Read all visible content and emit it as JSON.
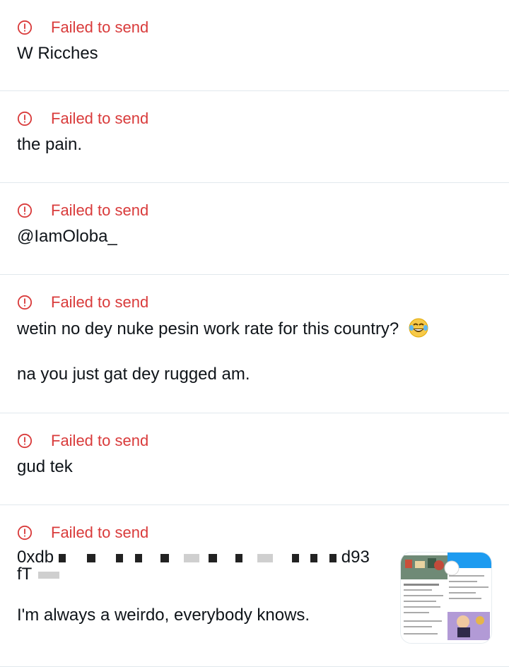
{
  "status_text": "Failed to send",
  "error_color": "#d93b3b",
  "icons": {
    "error": "error-circle-icon",
    "emoji": "tears-of-joy-emoji"
  },
  "messages": [
    {
      "lines": [
        "W Ricches"
      ]
    },
    {
      "lines": [
        "the pain."
      ]
    },
    {
      "lines": [
        "@IamOloba_"
      ]
    },
    {
      "lines": [
        "wetin no dey nuke pesin work rate for this country?",
        "na you just gat dey rugged am."
      ],
      "emoji": "😂"
    },
    {
      "lines": [
        "gud tek"
      ]
    },
    {
      "garbled_line_1_start": "0xdb",
      "garbled_line_1_end": "d93",
      "garbled_line_2": "fT",
      "lines": [
        "I'm always a weirdo, everybody knows."
      ],
      "has_thumbnail": true
    }
  ]
}
